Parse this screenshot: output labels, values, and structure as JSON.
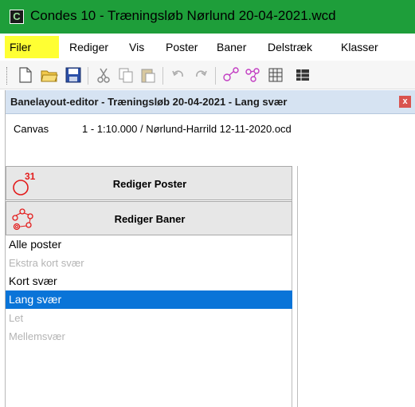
{
  "titlebar": {
    "app_icon": "C",
    "title": "Condes 10 - Træningsløb Nørlund 20-04-2021.wcd"
  },
  "menubar": {
    "items": [
      "Filer",
      "Rediger",
      "Vis",
      "Poster",
      "Baner",
      "Delstræk",
      "Klasser"
    ],
    "highlighted": "Filer"
  },
  "toolbar": {
    "buttons": [
      "new-document-icon",
      "open-folder-icon",
      "save-icon",
      "cut-icon",
      "copy-icon",
      "paste-icon",
      "undo-icon",
      "redo-icon",
      "controls-icon",
      "courses-icon",
      "grid-icon",
      "table-icon"
    ]
  },
  "document": {
    "title": "Banelayout-editor - Træningsløb 20-04-2021 - Lang svær",
    "close_label": "x",
    "canvas_label": "Canvas",
    "canvas_value": "1 - 1:10.000 / Nørlund-Harrild 12-11-2020.ocd",
    "edit_controls_label": "Rediger Poster",
    "edit_controls_badge": "31",
    "edit_courses_label": "Rediger Baner",
    "courses": [
      {
        "name": "Alle poster",
        "state": "normal"
      },
      {
        "name": "Ekstra kort svær",
        "state": "dim"
      },
      {
        "name": "Kort svær",
        "state": "normal"
      },
      {
        "name": "Lang svær",
        "state": "selected"
      },
      {
        "name": "Let",
        "state": "dim"
      },
      {
        "name": "Mellemsvær",
        "state": "dim"
      }
    ]
  },
  "colors": {
    "titlebar": "#1e9e3a",
    "highlight": "#ffff33",
    "selection": "#0a74d8",
    "control_symbol": "#e31b1b"
  }
}
